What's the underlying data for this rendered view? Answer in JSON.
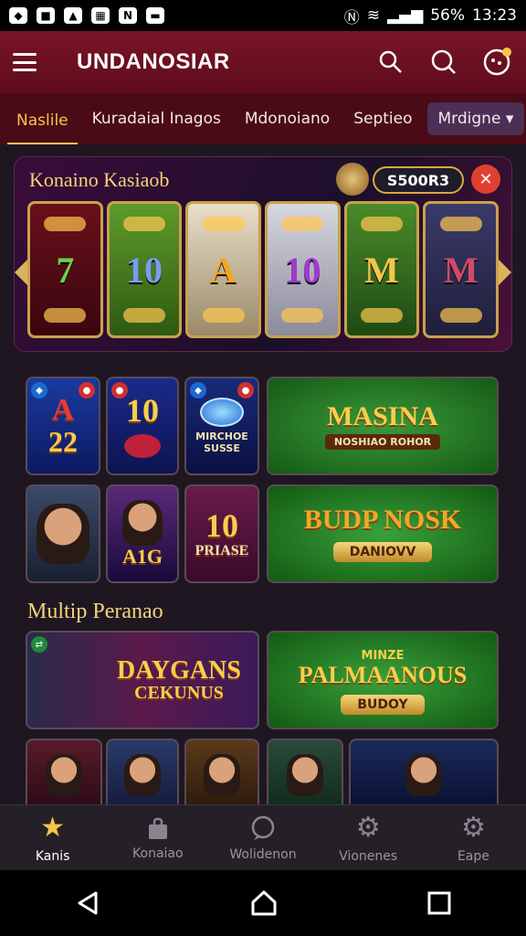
{
  "status_bar": {
    "battery": "56%",
    "time": "13:23"
  },
  "app_bar": {
    "title": "UNDANOSIAR"
  },
  "tabs": [
    {
      "label": "Naslile"
    },
    {
      "label": "Kuradaial Inagos"
    },
    {
      "label": "Mdonoiano"
    },
    {
      "label": "Septieo"
    },
    {
      "label": "Mrdigne"
    }
  ],
  "hero": {
    "title": "Konaino Kasiaob",
    "score": "S500R3",
    "reels": [
      "7",
      "10",
      "A",
      "10",
      "M",
      "M"
    ]
  },
  "tiles": {
    "a22": {
      "line1": "A",
      "line2": "22"
    },
    "ten1": {
      "text": "10"
    },
    "chip": {
      "caption": "MIRCHOE SUSSE"
    },
    "masina": {
      "title": "MASINA",
      "caption": "NOSHIAO ROHOR"
    },
    "a1g": {
      "text": "A1G"
    },
    "priase": {
      "title": "10",
      "caption": "PRIASE"
    },
    "budp": {
      "title": "BUDP NOSK",
      "button": "DANIOVV"
    }
  },
  "section": {
    "title": "Multip Peranao"
  },
  "promo": {
    "left": {
      "title": "DAYGANS",
      "subtitle": "CEKUNUS"
    },
    "right": {
      "eyebrow": "MINZE",
      "title": "PALMAANOUS",
      "button": "BUDOY"
    }
  },
  "bottom_nav": [
    {
      "label": "Kanis",
      "icon": "star-icon"
    },
    {
      "label": "Konaiao",
      "icon": "bag-icon"
    },
    {
      "label": "Wolidenon",
      "icon": "chat-icon"
    },
    {
      "label": "Vionenes",
      "icon": "gear-icon"
    },
    {
      "label": "Eape",
      "icon": "gear-icon"
    }
  ],
  "colors": {
    "accent": "#f3c54a",
    "appbar": "#7a1426",
    "tabs_bg": "#4a0a16"
  }
}
